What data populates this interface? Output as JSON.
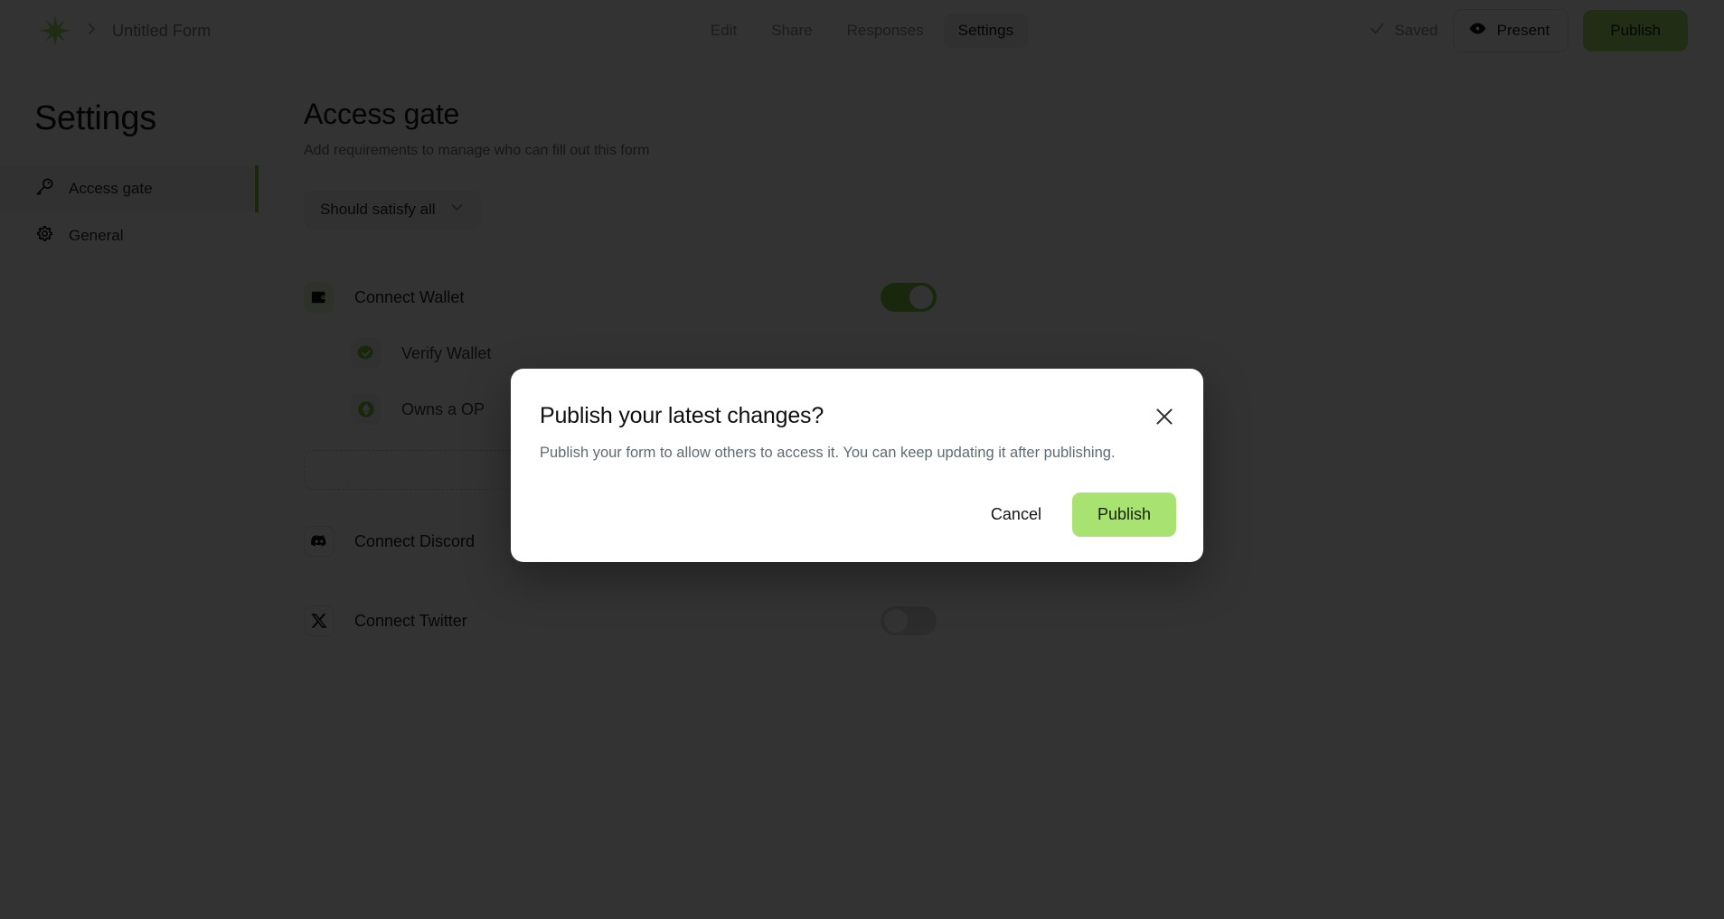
{
  "topbar": {
    "logo_icon": "star-logo-icon",
    "separator_icon": "chevron-right-icon",
    "form_title": "Untitled Form",
    "tabs": [
      {
        "label": "Edit",
        "active": false
      },
      {
        "label": "Share",
        "active": false
      },
      {
        "label": "Responses",
        "active": false
      },
      {
        "label": "Settings",
        "active": true
      }
    ],
    "saved_label": "Saved",
    "saved_icon": "check-icon",
    "present_label": "Present",
    "present_icon": "eye-icon",
    "publish_label": "Publish"
  },
  "sidebar": {
    "title": "Settings",
    "items": [
      {
        "label": "Access gate",
        "icon": "key-icon",
        "active": true
      },
      {
        "label": "General",
        "icon": "gear-icon",
        "active": false
      }
    ]
  },
  "main": {
    "heading": "Access gate",
    "subheading": "Add requirements to manage who can fill out this form",
    "satisfy_select": {
      "value": "Should satisfy all",
      "icon": "chevron-down-icon"
    },
    "requirements": [
      {
        "label": "Connect Wallet",
        "icon": "wallet-icon",
        "toggle": "on",
        "indent": false
      },
      {
        "label": "Verify Wallet",
        "icon": "verified-badge-icon",
        "toggle": null,
        "indent": true
      },
      {
        "label": "Owns a OP",
        "icon": "optimism-token-icon",
        "toggle": null,
        "indent": true
      },
      {
        "label": "Connect Discord",
        "icon": "discord-icon",
        "toggle": "off",
        "indent": false
      },
      {
        "label": "Connect Twitter",
        "icon": "x-twitter-icon",
        "toggle": "off",
        "indent": false
      }
    ]
  },
  "modal": {
    "title": "Publish your latest changes?",
    "body": "Publish your form to allow others to access it. You can keep updating it after publishing.",
    "close_icon": "close-icon",
    "cancel_label": "Cancel",
    "publish_label": "Publish"
  },
  "colors": {
    "accent_green": "#a8e271",
    "active_green": "#7fc93c",
    "overlay": "rgba(0,0,0,0.80)"
  }
}
